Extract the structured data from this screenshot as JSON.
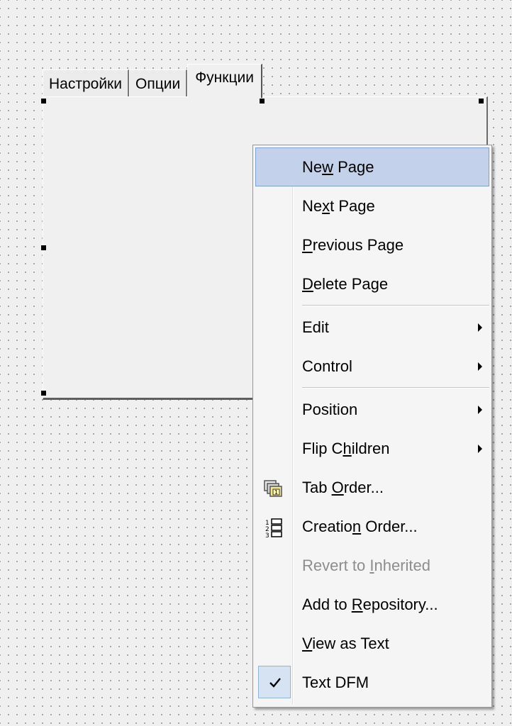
{
  "tabs": [
    {
      "label": "Настройки",
      "active": false
    },
    {
      "label": "Опции",
      "active": false
    },
    {
      "label": "Функции",
      "active": true
    }
  ],
  "context_menu": {
    "items": [
      {
        "pre": "Ne",
        "acc": "w",
        "post": " Page",
        "highlighted": true
      },
      {
        "pre": "Ne",
        "acc": "x",
        "post": "t Page"
      },
      {
        "pre": "",
        "acc": "P",
        "post": "revious Page"
      },
      {
        "pre": "",
        "acc": "D",
        "post": "elete Page"
      },
      {
        "label": "Edit",
        "submenu": true
      },
      {
        "label": "Control",
        "submenu": true
      },
      {
        "label": "Position",
        "submenu": true
      },
      {
        "pre": "Flip C",
        "acc": "h",
        "post": "ildren",
        "submenu": true
      },
      {
        "pre": "Tab ",
        "acc": "O",
        "post": "rder...",
        "icon": "tab-order-icon"
      },
      {
        "pre": "Creatio",
        "acc": "n",
        "post": " Order...",
        "icon": "creation-order-icon"
      },
      {
        "pre": "Revert to ",
        "acc": "I",
        "post": "nherited",
        "disabled": true
      },
      {
        "pre": "Add to ",
        "acc": "R",
        "post": "epository..."
      },
      {
        "pre": "",
        "acc": "V",
        "post": "iew as Text"
      },
      {
        "label": "Text DFM",
        "checked": true
      }
    ]
  },
  "colors": {
    "highlight": "#c3d1ea",
    "highlight_border": "#7da2ce",
    "disabled_text": "#8d8d8d"
  }
}
